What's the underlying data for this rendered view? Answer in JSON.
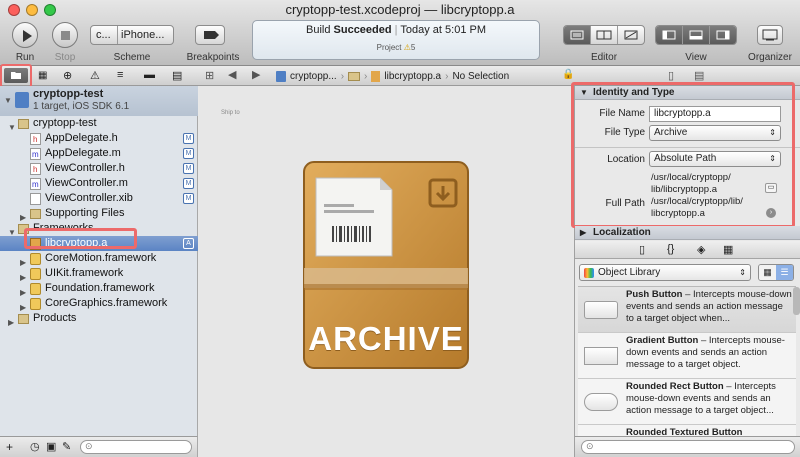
{
  "window": {
    "title": "cryptopp-test.xcodeproj — libcryptopp.a"
  },
  "toolbar": {
    "run_label": "Run",
    "stop_label": "Stop",
    "scheme_label": "Scheme",
    "scheme_target": "c...",
    "scheme_device": "iPhone...",
    "breakpoints_label": "Breakpoints",
    "editor_label": "Editor",
    "view_label": "View",
    "organizer_label": "Organizer"
  },
  "activity": {
    "build_prefix": "Build ",
    "build_status": "Succeeded",
    "time": "Today at 5:01 PM",
    "project_label": "Project",
    "warning_count": "5"
  },
  "jump_bar": {
    "crumb_project": "cryptopp...",
    "crumb_file": "libcryptopp.a",
    "selection": "No Selection"
  },
  "navigator": {
    "project_name": "cryptopp-test",
    "project_subtitle": "1 target, iOS SDK 6.1",
    "items": [
      {
        "label": "cryptopp-test",
        "kind": "folder",
        "badge": ""
      },
      {
        "label": "AppDelegate.h",
        "kind": "h",
        "badge": "M"
      },
      {
        "label": "AppDelegate.m",
        "kind": "m",
        "badge": "M"
      },
      {
        "label": "ViewController.h",
        "kind": "h",
        "badge": "M"
      },
      {
        "label": "ViewController.m",
        "kind": "m",
        "badge": "M"
      },
      {
        "label": "ViewController.xib",
        "kind": "xib",
        "badge": "M"
      },
      {
        "label": "Supporting Files",
        "kind": "folder",
        "badge": ""
      },
      {
        "label": "Frameworks",
        "kind": "folder",
        "badge": ""
      },
      {
        "label": "libcryptopp.a",
        "kind": "lib",
        "badge": "A"
      },
      {
        "label": "CoreMotion.framework",
        "kind": "framework",
        "badge": ""
      },
      {
        "label": "UIKit.framework",
        "kind": "framework",
        "badge": ""
      },
      {
        "label": "Foundation.framework",
        "kind": "framework",
        "badge": ""
      },
      {
        "label": "CoreGraphics.framework",
        "kind": "framework",
        "badge": ""
      },
      {
        "label": "Products",
        "kind": "folder",
        "badge": ""
      }
    ]
  },
  "editor": {
    "archive_label": "ARCHIVE",
    "stamp_text": "Ship to"
  },
  "inspector": {
    "identity_header": "Identity and Type",
    "file_name_label": "File Name",
    "file_name_value": "libcryptopp.a",
    "file_type_label": "File Type",
    "file_type_value": "Archive",
    "location_label": "Location",
    "location_value": "Absolute Path",
    "location_path": "/usr/local/cryptopp/lib/libcryptopp.a",
    "location_path_l1": "/usr/local/cryptopp/",
    "location_path_l2": "lib/libcryptopp.a",
    "full_path_label": "Full Path",
    "full_path_l1": "/usr/local/cryptopp/lib/",
    "full_path_l2": "libcryptopp.a",
    "localization_header": "Localization",
    "library_popup": "Object Library",
    "library_items": [
      {
        "title": "Push Button",
        "desc": " – Intercepts mouse-down events and sends an action message to a target object when..."
      },
      {
        "title": "Gradient Button",
        "desc": " – Intercepts mouse-down events and sends an action message to a target object."
      },
      {
        "title": "Rounded Rect Button",
        "desc": " – Intercepts mouse-down events and sends an action message to a target object..."
      },
      {
        "title": "Rounded Textured Button",
        "desc": ""
      }
    ]
  },
  "colors": {
    "highlight": "#ec6a6a",
    "selection": "#5b84c4",
    "archive_brown": "#c88b3a"
  }
}
